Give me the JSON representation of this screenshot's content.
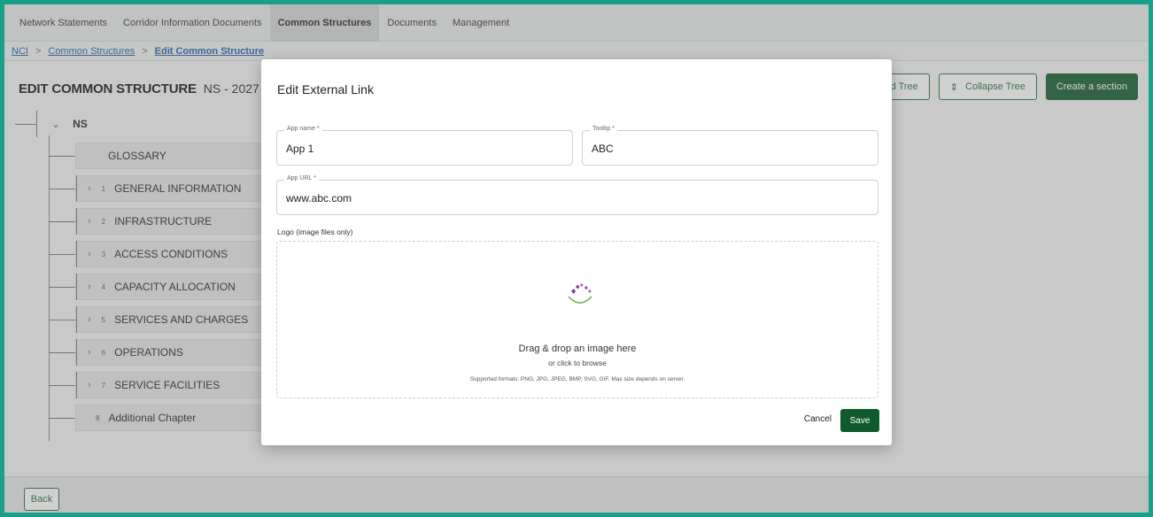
{
  "topnav": {
    "tabs": [
      {
        "label": "Network Statements"
      },
      {
        "label": "Corridor Information Documents"
      },
      {
        "label": "Common Structures"
      },
      {
        "label": "Documents"
      },
      {
        "label": "Management"
      }
    ]
  },
  "breadcrumb": {
    "root": "NCI",
    "sep": ">",
    "parent": "Common Structures",
    "current": "Edit Common Structure"
  },
  "header": {
    "title": "EDIT COMMON STRUCTURE",
    "code": "NS - 2027",
    "expand_label": "nd Tree",
    "collapse_label": "Collapse Tree",
    "create_label": "Create a section"
  },
  "tree": {
    "root_label": "NS",
    "nodes": [
      {
        "num": "",
        "label": "GLOSSARY"
      },
      {
        "num": "1",
        "label": "GENERAL INFORMATION"
      },
      {
        "num": "2",
        "label": "INFRASTRUCTURE"
      },
      {
        "num": "3",
        "label": "ACCESS CONDITIONS"
      },
      {
        "num": "4",
        "label": "CAPACITY ALLOCATION"
      },
      {
        "num": "5",
        "label": "SERVICES AND CHARGES"
      },
      {
        "num": "6",
        "label": "OPERATIONS"
      },
      {
        "num": "7",
        "label": "SERVICE FACILITIES"
      },
      {
        "num": "8",
        "label": "Additional Chapter"
      }
    ]
  },
  "bottom": {
    "back_label": "Back"
  },
  "modal": {
    "title": "Edit External Link",
    "app_name": {
      "label": "App name *",
      "value": "App 1"
    },
    "tooltip": {
      "label": "Tooltip *",
      "value": "ABC"
    },
    "app_url": {
      "label": "App URL *",
      "value": "www.abc.com"
    },
    "logo_label": "Logo (image files only)",
    "dropzone": {
      "main": "Drag & drop an image here",
      "sub": "or click to browse",
      "formats": "Supported formats: PNG, JPG, JPEG, BMP, SVG, GIF. Max size depends on server."
    },
    "cancel_label": "Cancel",
    "save_label": "Save"
  },
  "colors": {
    "accent_green": "#0e5a2a",
    "frame_teal": "#18a08a",
    "link_blue": "#1b5fa8",
    "logo_purple": "#8a3a9a",
    "logo_green": "#6ab04c"
  }
}
